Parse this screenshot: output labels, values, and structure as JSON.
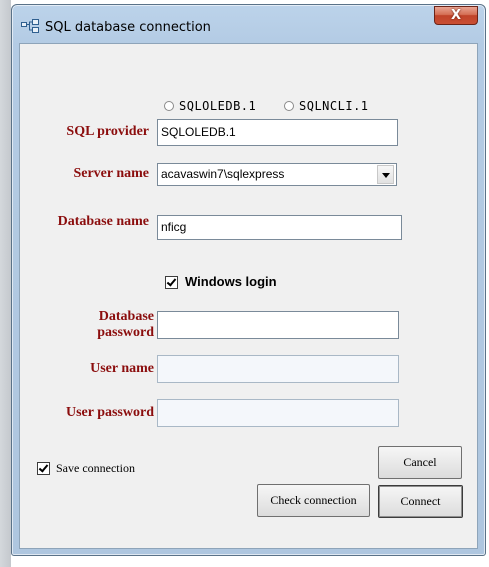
{
  "window": {
    "title": "SQL database connection",
    "close_label": "X"
  },
  "provider": {
    "options": [
      "SQLOLEDB.1",
      "SQLNCLI.1"
    ],
    "label": "SQL provider",
    "value": "SQLOLEDB.1"
  },
  "server": {
    "label": "Server name",
    "value": "acavaswin7\\sqlexpress"
  },
  "database": {
    "label": "Database name",
    "value": "nficg"
  },
  "windows_login": {
    "label": "Windows login",
    "checked": true
  },
  "db_password": {
    "label_line1": "Database",
    "label_line2": "password",
    "value": ""
  },
  "user_name": {
    "label": "User name",
    "value": ""
  },
  "user_password": {
    "label": "User password",
    "value": ""
  },
  "save_connection": {
    "label": "Save connection",
    "checked": true
  },
  "buttons": {
    "cancel": "Cancel",
    "check": "Check connection",
    "connect": "Connect"
  }
}
